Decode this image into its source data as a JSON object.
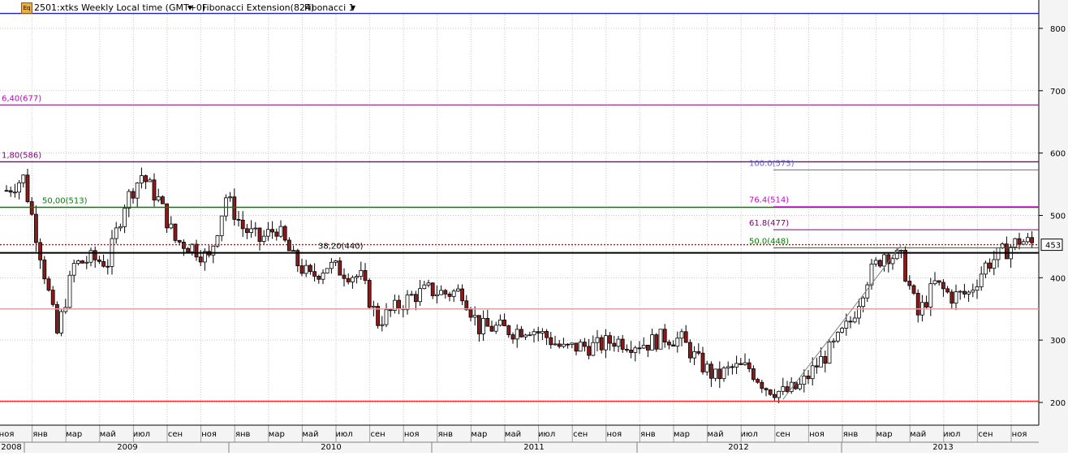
{
  "header": {
    "symbol_label": "2501:xtks Weekly Local time (GMT+0)",
    "symbol_icon": "chart-app-icon",
    "dropdown_icon": "chevron-down-icon",
    "ext_tool_label": "Fibonacci Extension(824)",
    "retrace_tool_label": "Fibonacci 1"
  },
  "colors": {
    "up_candle": "#ffffff",
    "down_candle": "#8b1a1a",
    "grid": "#c8c8c8",
    "blue_line": "#2020c0",
    "magenta_line": "#e000e0",
    "purple_line": "#800080",
    "green_line": "#008000",
    "black_line": "#000000",
    "red_dotted": "#e00000",
    "pink_line": "#e0a0a0",
    "red_line": "#ff2020"
  },
  "chart_data": {
    "type": "candlestick",
    "ylim": [
      190,
      840
    ],
    "y_ticks": [
      "200",
      "300",
      "400",
      "500",
      "600",
      "700",
      "800"
    ],
    "last_price_label": "453",
    "last_price": 453,
    "months": [
      "ноя",
      "янв",
      "мар",
      "май",
      "июл",
      "сен",
      "ноя",
      "янв",
      "мар",
      "май",
      "июл",
      "сен",
      "ноя",
      "янв",
      "мар",
      "май",
      "июл",
      "сен",
      "ноя",
      "янв",
      "мар",
      "май",
      "июл",
      "сен",
      "ноя",
      "янв",
      "мар",
      "май",
      "июл",
      "сен",
      "ноя"
    ],
    "years": [
      "2008",
      "2009",
      "2010",
      "2011",
      "2012",
      "2013"
    ],
    "levels": [
      {
        "value": 824,
        "color_key": "blue_line",
        "style": "solid",
        "label": ""
      },
      {
        "value": 677,
        "color_key": "magenta_line",
        "style": "solid",
        "label": "6,40(677)"
      },
      {
        "value": 586,
        "color_key": "purple_line",
        "style": "solid",
        "label": "1,80(586)"
      },
      {
        "value": 513,
        "color_key": "green_line",
        "style": "solid",
        "label": "50,00(513)"
      },
      {
        "value": 440,
        "color_key": "black_line",
        "style": "solid",
        "label": "38,20(440)"
      },
      {
        "value": 453,
        "color_key": "red_dotted",
        "style": "dotted",
        "label": ""
      },
      {
        "value": 350,
        "color_key": "pink_line",
        "style": "solid",
        "label": ""
      },
      {
        "value": 202,
        "color_key": "red_line",
        "style": "solid",
        "label": ""
      }
    ],
    "fib_retracement": [
      {
        "value": 573,
        "label": "100.0(573)"
      },
      {
        "value": 514,
        "label": "76.4(514)"
      },
      {
        "value": 477,
        "label": "61.8(477)"
      },
      {
        "value": 448,
        "label": "50.0(448)"
      }
    ],
    "trendline": {
      "from": [
        "2012-09",
        205
      ],
      "to": [
        "2013-04",
        452
      ]
    },
    "weekly_close_path": [
      [
        "2008-11",
        540
      ],
      [
        "2008-12",
        560
      ],
      [
        "2009-01",
        440
      ],
      [
        "2009-02",
        310
      ],
      [
        "2009-03",
        420
      ],
      [
        "2009-04",
        430
      ],
      [
        "2009-05",
        425
      ],
      [
        "2009-06",
        520
      ],
      [
        "2009-07",
        565
      ],
      [
        "2009-08",
        525
      ],
      [
        "2009-09",
        460
      ],
      [
        "2009-10",
        450
      ],
      [
        "2009-11",
        430
      ],
      [
        "2009-12",
        530
      ],
      [
        "2010-01",
        480
      ],
      [
        "2010-02",
        460
      ],
      [
        "2010-03",
        480
      ],
      [
        "2010-04",
        430
      ],
      [
        "2010-05",
        400
      ],
      [
        "2010-06",
        420
      ],
      [
        "2010-07",
        410
      ],
      [
        "2010-08",
        400
      ],
      [
        "2010-09",
        330
      ],
      [
        "2010-10",
        350
      ],
      [
        "2010-11",
        370
      ],
      [
        "2010-12",
        380
      ],
      [
        "2011-01",
        375
      ],
      [
        "2011-02",
        378
      ],
      [
        "2011-03",
        320
      ],
      [
        "2011-04",
        320
      ],
      [
        "2011-05",
        315
      ],
      [
        "2011-06",
        320
      ],
      [
        "2011-07",
        305
      ],
      [
        "2011-08",
        285
      ],
      [
        "2011-09",
        290
      ],
      [
        "2011-10",
        290
      ],
      [
        "2011-11",
        300
      ],
      [
        "2011-12",
        295
      ],
      [
        "2012-01",
        295
      ],
      [
        "2012-02",
        305
      ],
      [
        "2012-03",
        300
      ],
      [
        "2012-04",
        265
      ],
      [
        "2012-05",
        240
      ],
      [
        "2012-06",
        255
      ],
      [
        "2012-07",
        255
      ],
      [
        "2012-08",
        225
      ],
      [
        "2012-09",
        215
      ],
      [
        "2012-10",
        225
      ],
      [
        "2012-11",
        260
      ],
      [
        "2012-12",
        290
      ],
      [
        "2013-01",
        330
      ],
      [
        "2013-02",
        400
      ],
      [
        "2013-03",
        440
      ],
      [
        "2013-04",
        430
      ],
      [
        "2013-05",
        340
      ],
      [
        "2013-06",
        390
      ],
      [
        "2013-07",
        370
      ],
      [
        "2013-08",
        375
      ],
      [
        "2013-09",
        420
      ],
      [
        "2013-10",
        440
      ],
      [
        "2013-11",
        460
      ],
      [
        "2013-12",
        453
      ]
    ]
  }
}
